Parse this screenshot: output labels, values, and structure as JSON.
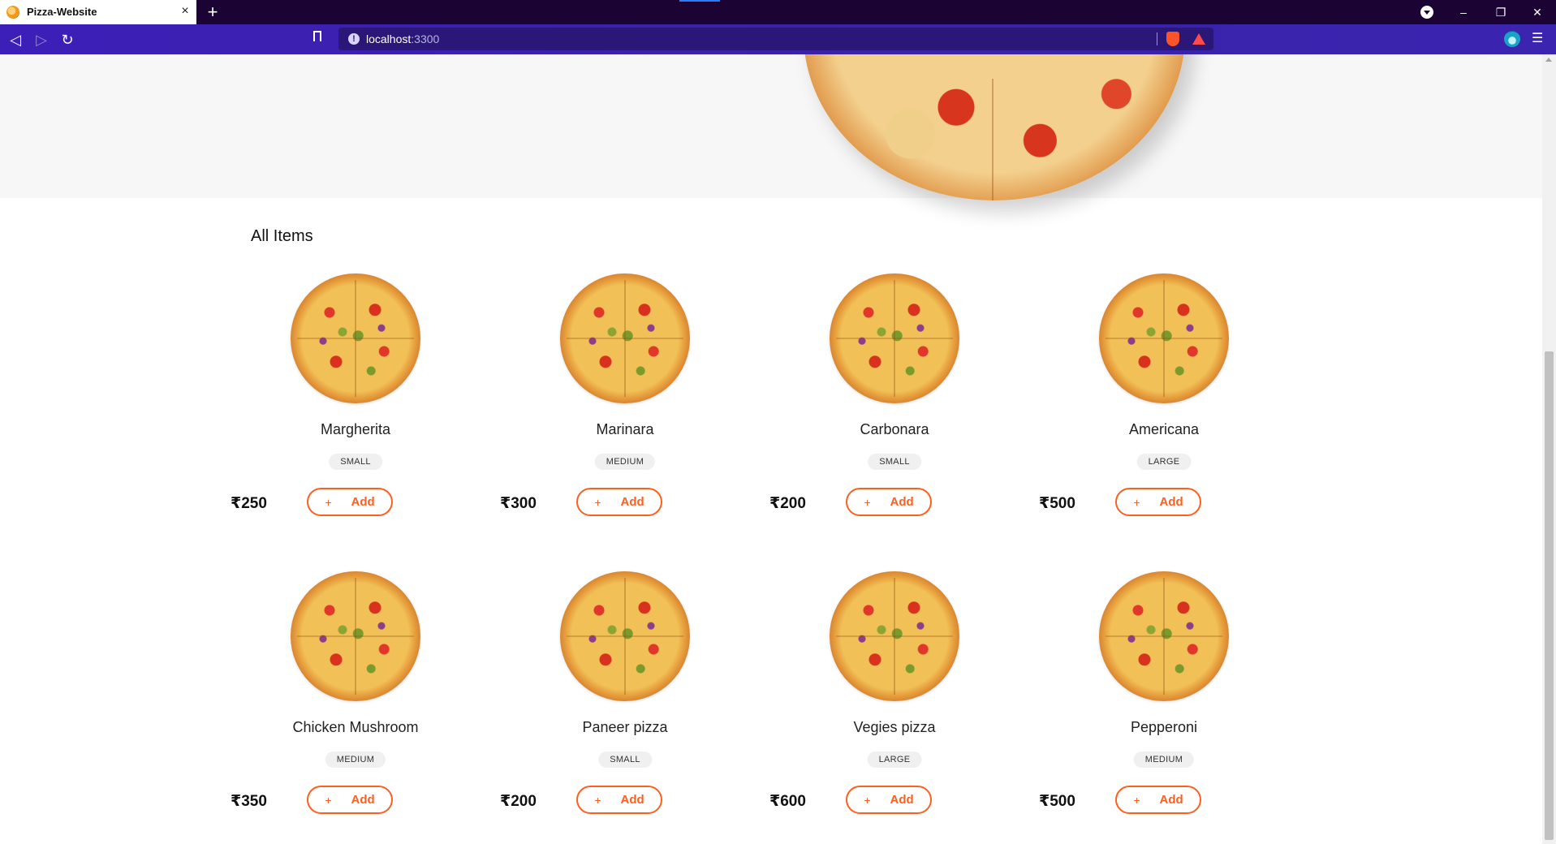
{
  "browser": {
    "tab_title": "Pizza-Website",
    "tab_close": "×",
    "new_tab": "+",
    "url_host": "localhost",
    "url_port": ":3300",
    "info_glyph": "!",
    "minimize": "–",
    "restore": "❐",
    "close": "✕",
    "back": "◁",
    "forward": "▷",
    "reload": "↻",
    "menu": "☰"
  },
  "page": {
    "section_title": "All Items",
    "add_label": "Add",
    "add_plus": "+",
    "items": [
      {
        "name": "Margherita",
        "size": "SMALL",
        "price": "₹250"
      },
      {
        "name": "Marinara",
        "size": "MEDIUM",
        "price": "₹300"
      },
      {
        "name": "Carbonara",
        "size": "SMALL",
        "price": "₹200"
      },
      {
        "name": "Americana",
        "size": "LARGE",
        "price": "₹500"
      },
      {
        "name": "Chicken Mushroom",
        "size": "MEDIUM",
        "price": "₹350"
      },
      {
        "name": "Paneer pizza",
        "size": "SMALL",
        "price": "₹200"
      },
      {
        "name": "Vegies pizza",
        "size": "LARGE",
        "price": "₹600"
      },
      {
        "name": "Pepperoni",
        "size": "MEDIUM",
        "price": "₹500"
      }
    ]
  },
  "colors": {
    "accent": "#fe5f1e",
    "tabbar": "#1b0433",
    "addressbar": "#3b22ae",
    "hero_bg": "#f7f7f7"
  },
  "icons": [
    "pizza-favicon-icon",
    "close-icon",
    "plus-icon",
    "back-icon",
    "forward-icon",
    "reload-icon",
    "bookmark-icon",
    "info-icon",
    "brave-shield-icon",
    "bat-rewards-icon",
    "sync-icon",
    "menu-icon",
    "profile-icon",
    "minimize-icon",
    "restore-icon"
  ]
}
